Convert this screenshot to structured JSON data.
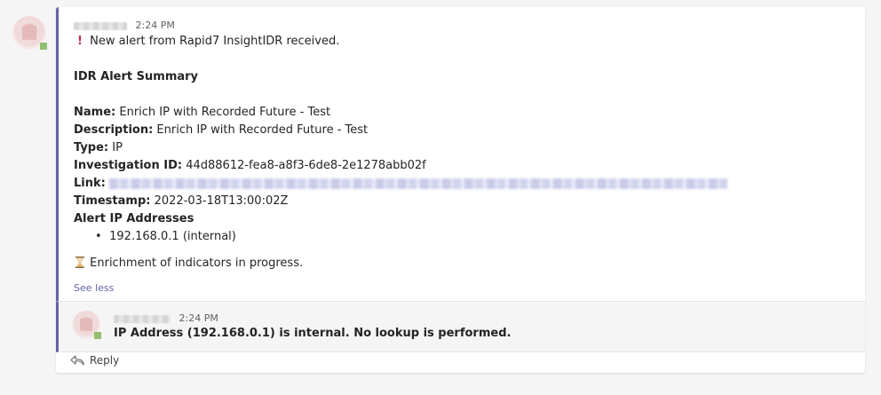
{
  "main_message": {
    "timestamp": "2:24 PM",
    "alert_icon": "exclamation-icon",
    "alert_line": "New alert from Rapid7 InsightIDR received.",
    "summary_title": "IDR Alert Summary",
    "fields": {
      "name_label": "Name:",
      "name_value": "Enrich IP with Recorded Future - Test",
      "description_label": "Description:",
      "description_value": "Enrich IP with Recorded Future - Test",
      "type_label": "Type:",
      "type_value": "IP",
      "investigation_label": "Investigation ID:",
      "investigation_value": "44d88612-fea8-a8f3-6de8-2e1278abb02f",
      "link_label": "Link:",
      "timestamp_label": "Timestamp:",
      "timestamp_value": "2022-03-18T13:00:02Z",
      "ip_addresses_label": "Alert IP Addresses"
    },
    "ip_list": [
      "192.168.0.1 (internal)"
    ],
    "enrichment_icon": "hourglass-icon",
    "enrichment_line": "Enrichment of indicators in progress.",
    "see_less": "See less"
  },
  "reply_message": {
    "timestamp": "2:24 PM",
    "text": "IP Address (192.168.0.1) is internal. No lookup is performed."
  },
  "reply_button": {
    "icon": "reply-arrow-icon",
    "label": "Reply"
  },
  "colors": {
    "accent": "#6264a7",
    "alert_red": "#c4314b",
    "background": "#f5f5f5"
  }
}
